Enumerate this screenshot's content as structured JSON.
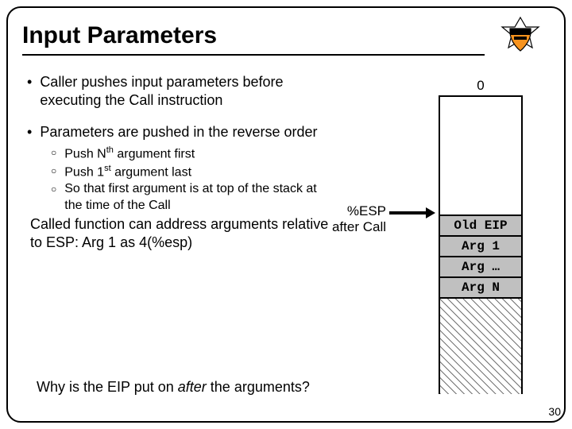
{
  "title": "Input Parameters",
  "bullet1": "Caller pushes input parameters before executing the Call instruction",
  "bullet2": "Parameters are pushed in the reverse order",
  "sub": {
    "a_pre": "Push N",
    "a_sup": "th",
    "a_post": " argument first",
    "b_pre": "Push 1",
    "b_sup": "st",
    "b_post": " argument last",
    "c": "So that first argument is at top of the stack at the time of the Call"
  },
  "called": "Called function can address arguments relative to ESP: Arg 1 as 4(%esp)",
  "question_pre": "Why is the EIP put on ",
  "question_em": "after",
  "question_post": " the arguments?",
  "stack": {
    "zero": "0",
    "cells": [
      "Old EIP",
      "Arg 1",
      "Arg …",
      "Arg N"
    ]
  },
  "esp_label_line1": "%ESP",
  "esp_label_line2": "after Call",
  "page": "30"
}
